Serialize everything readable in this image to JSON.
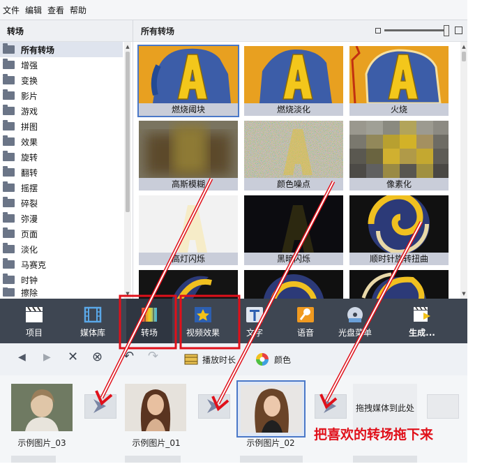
{
  "menu": [
    "文件",
    "编辑",
    "查看",
    "帮助"
  ],
  "left_panel": {
    "title": "转场",
    "items": [
      "所有转场",
      "增强",
      "变换",
      "影片",
      "游戏",
      "拼图",
      "效果",
      "旋转",
      "翻转",
      "摇摆",
      "碎裂",
      "弥漫",
      "页面",
      "淡化",
      "马赛克",
      "时钟",
      "擦除"
    ]
  },
  "right_panel": {
    "title": "所有转场",
    "thumbnails": [
      "燃烧阈块",
      "燃烧淡化",
      "火烧",
      "高斯模糊",
      "颜色噪点",
      "像素化",
      "高灯闪烁",
      "黑暗闪烁",
      "顺时针旋转扭曲",
      "",
      "",
      ""
    ]
  },
  "toolbar": {
    "items": [
      "项目",
      "媒体库",
      "转场",
      "视频效果",
      "文字",
      "语音",
      "光盘菜单",
      "生成..."
    ]
  },
  "edit_bar": {
    "duration_label": "播放时长",
    "color_label": "颜色"
  },
  "timeline": {
    "clips": [
      "示例图片_03",
      "示例图片_01",
      "示例图片_02"
    ],
    "drop_hint": "拖拽媒体到此处"
  },
  "annotation": "把喜欢的转场拖下来",
  "colors": {
    "toolbar_bg": "#3e4652",
    "selection": "#4a78c8",
    "annotation": "#e0101a"
  }
}
